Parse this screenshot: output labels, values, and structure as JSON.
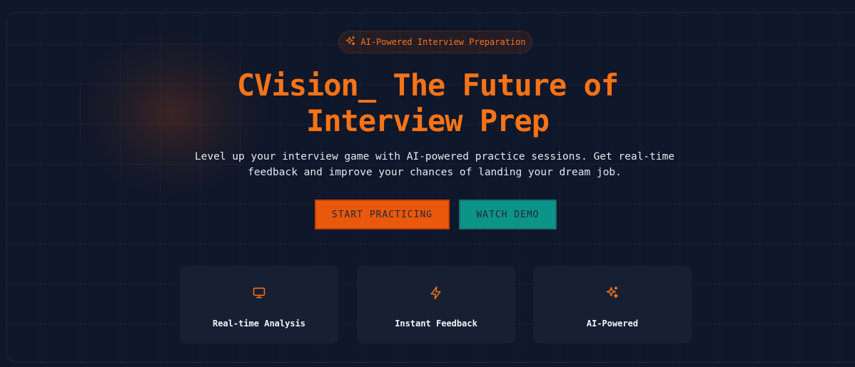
{
  "badge": {
    "icon": "sparkles-icon",
    "label": "AI-Powered Interview Preparation"
  },
  "hero": {
    "title_line1": "CVision_ The Future of",
    "title_line2": "Interview Prep",
    "subtitle_line1": "Level up your interview game with AI-powered practice sessions. Get real-time",
    "subtitle_line2": "feedback and improve your chances of landing your dream job."
  },
  "buttons": {
    "start_label": "START PRACTICING",
    "demo_label": "WATCH DEMO"
  },
  "features": [
    {
      "icon": "monitor-icon",
      "label": "Real-time Analysis"
    },
    {
      "icon": "lightning-icon",
      "label": "Instant Feedback"
    },
    {
      "icon": "sparkles-icon",
      "label": "AI-Powered"
    }
  ],
  "colors": {
    "background": "#0f172a",
    "accent": "#f97316",
    "primary_button": "#ea580c",
    "secondary_button": "#0d9488",
    "card": "#172033"
  }
}
